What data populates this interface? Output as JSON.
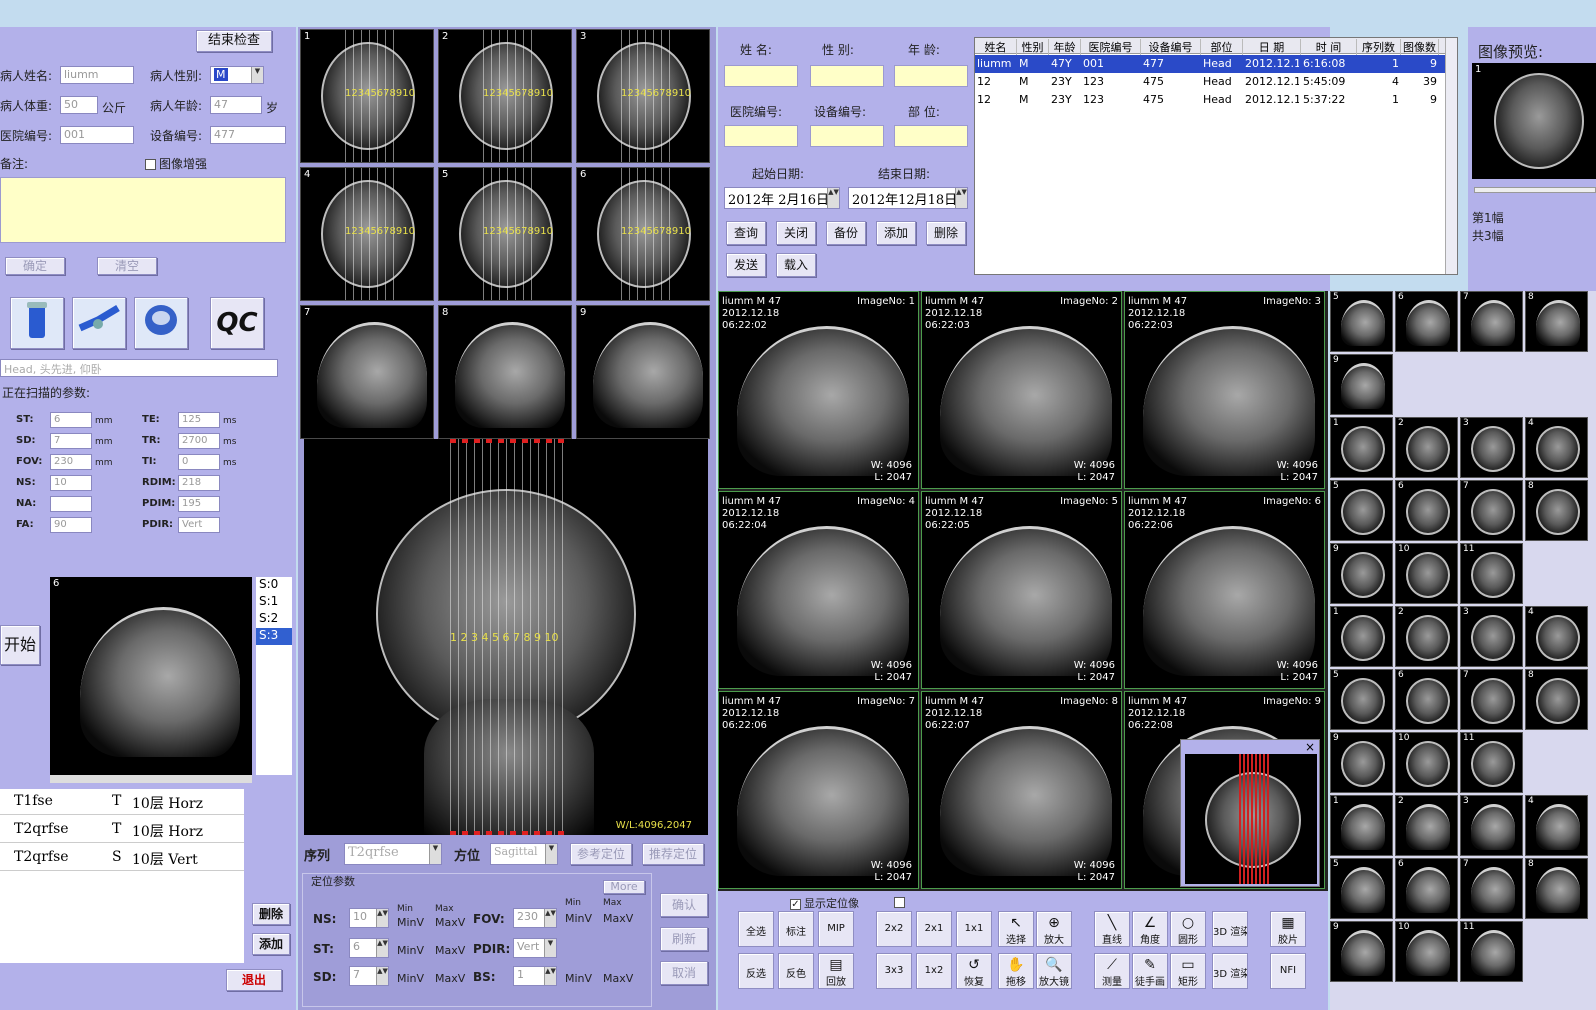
{
  "left_panel": {
    "end_exam_button": "结束检查",
    "patient_name_label": "病人姓名:",
    "patient_name_value": "liumm",
    "patient_sex_label": "病人性别:",
    "patient_sex_value": "M",
    "patient_weight_label": "病人体重:",
    "patient_weight_value": "50",
    "weight_unit": "公斤",
    "patient_age_label": "病人年龄:",
    "patient_age_value": "47",
    "age_unit": "岁",
    "hospital_no_label": "医院编号:",
    "hospital_no_value": "001",
    "device_no_label": "设备编号:",
    "device_no_value": "477",
    "notes_label": "备注:",
    "image_enhance_label": "图像增强",
    "confirm_button": "确定",
    "clear_button": "清空",
    "qc_label": "QC",
    "position_text": "Head, 头先进, 仰卧",
    "scanning_params_label": "正在扫描的参数:",
    "params_left": [
      {
        "label": "ST:",
        "value": "6",
        "unit": "mm"
      },
      {
        "label": "SD:",
        "value": "7",
        "unit": "mm"
      },
      {
        "label": "FOV:",
        "value": "230",
        "unit": "mm"
      },
      {
        "label": "NS:",
        "value": "10",
        "unit": ""
      },
      {
        "label": "NA:",
        "value": "",
        "unit": ""
      },
      {
        "label": "FA:",
        "value": "90",
        "unit": ""
      }
    ],
    "params_right": [
      {
        "label": "TE:",
        "value": "125",
        "unit": "ms"
      },
      {
        "label": "TR:",
        "value": "2700",
        "unit": "ms"
      },
      {
        "label": "TI:",
        "value": "0",
        "unit": "ms"
      },
      {
        "label": "RDIM:",
        "value": "218",
        "unit": ""
      },
      {
        "label": "PDIM:",
        "value": "195",
        "unit": ""
      },
      {
        "label": "PDIR:",
        "value": "Vert",
        "unit": ""
      }
    ],
    "start_button": "开始",
    "slice_list": [
      "S:0",
      "S:1",
      "S:2",
      "S:3"
    ],
    "selected_slice_index": 3,
    "sequences": [
      {
        "name": "T1fse",
        "type": "T",
        "layers": "10层 Horz"
      },
      {
        "name": "T2qrfse",
        "type": "T",
        "layers": "10层 Horz"
      },
      {
        "name": "T2qrfse",
        "type": "S",
        "layers": "10层 Vert"
      }
    ],
    "delete_button": "删除",
    "add_button": "添加",
    "exit_button": "退出"
  },
  "center_panel": {
    "localizer_numbers": [
      "1",
      "2",
      "3",
      "4",
      "5",
      "6",
      "7",
      "8",
      "9"
    ],
    "localizer_overlay_text": "12345678910",
    "slice_markers": "1 2 3 4 5 6 7 8 9 10",
    "wl_text": "W/L:4096,2047",
    "sequence_label": "序列",
    "sequence_value": "T2qrfse",
    "orientation_label": "方位",
    "orientation_value": "Sagittal",
    "ref_position_button": "参考定位",
    "auto_position_button": "推荐定位",
    "position_params_label": "定位参数",
    "more_button": "More",
    "ns_label": "NS:",
    "ns_value": "10",
    "st_label": "ST:",
    "st_value": "6",
    "sd_label": "SD:",
    "sd_value": "7",
    "fov_label": "FOV:",
    "fov_value": "230",
    "pdir_label": "PDIR:",
    "pdir_value": "Vert",
    "bs_label": "BS:",
    "bs_value": "1",
    "min_label": "Min",
    "max_label": "Max",
    "minv_label": "MinV",
    "maxv_label": "MaxV",
    "confirm_button": "确认",
    "refresh_button": "刷新",
    "cancel_button": "取消"
  },
  "search_panel": {
    "name_label": "姓  名:",
    "sex_label": "性  别:",
    "age_label": "年  龄:",
    "hospital_no_label": "医院编号:",
    "device_no_label": "设备编号:",
    "part_label": "部  位:",
    "start_date_label": "起始日期:",
    "end_date_label": "结束日期:",
    "start_date_value": "2012年 2月16日",
    "end_date_value": "2012年12月18日",
    "buttons": [
      "查询",
      "关闭",
      "备份",
      "添加",
      "删除",
      "发送",
      "载入"
    ],
    "table_headers": [
      "姓名",
      "性别",
      "年龄",
      "医院编号",
      "设备编号",
      "部位",
      "日 期",
      "时 间",
      "序列数",
      "图像数"
    ],
    "table_rows": [
      [
        "liumm",
        "M",
        "47Y",
        "001",
        "477",
        "Head",
        "2012.12.18",
        "6:16:08",
        "1",
        "9"
      ],
      [
        "12",
        "M",
        "23Y",
        "123",
        "475",
        "Head",
        "2012.12.18",
        "5:45:09",
        "4",
        "39"
      ],
      [
        "12",
        "M",
        "23Y",
        "123",
        "475",
        "Head",
        "2012.12.18",
        "5:37:22",
        "1",
        "9"
      ]
    ],
    "selected_row": 0
  },
  "preview_panel": {
    "title": "图像预览:",
    "frame_number": "1",
    "current_frame_text": "第1幅",
    "total_frames_text": "共3幅"
  },
  "viewer": {
    "images": [
      {
        "name": "liumm M 47",
        "date": "2012.12.18",
        "time": "06:22:02",
        "image_no": "ImageNo: 1",
        "w": "W: 4096",
        "l": "L: 2047"
      },
      {
        "name": "liumm M 47",
        "date": "2012.12.18",
        "time": "06:22:03",
        "image_no": "ImageNo: 2",
        "w": "W: 4096",
        "l": "L: 2047"
      },
      {
        "name": "liumm M 47",
        "date": "2012.12.18",
        "time": "06:22:03",
        "image_no": "ImageNo: 3",
        "w": "W: 4096",
        "l": "L: 2047"
      },
      {
        "name": "liumm M 47",
        "date": "2012.12.18",
        "time": "06:22:04",
        "image_no": "ImageNo: 4",
        "w": "W: 4096",
        "l": "L: 2047"
      },
      {
        "name": "liumm M 47",
        "date": "2012.12.18",
        "time": "06:22:05",
        "image_no": "ImageNo: 5",
        "w": "W: 4096",
        "l": "L: 2047"
      },
      {
        "name": "liumm M 47",
        "date": "2012.12.18",
        "time": "06:22:06",
        "image_no": "ImageNo: 6",
        "w": "W: 4096",
        "l": "L: 2047"
      },
      {
        "name": "liumm M 47",
        "date": "2012.12.18",
        "time": "06:22:06",
        "image_no": "ImageNo: 7",
        "w": "W: 4096",
        "l": "L: 2047"
      },
      {
        "name": "liumm M 47",
        "date": "2012.12.18",
        "time": "06:22:07",
        "image_no": "ImageNo: 8",
        "w": "W: 4096",
        "l": "L: 2047"
      },
      {
        "name": "liumm M 47",
        "date": "2012.12.18",
        "time": "06:22:08",
        "image_no": "ImageNo: 9",
        "w": "W: 4096",
        "l": "L: 2047"
      }
    ],
    "show_locator_label": "显示定位像",
    "close_popup": "×",
    "toolbar_row1": [
      "全选",
      "标注",
      "MIP",
      "2x2",
      "2x1",
      "1x1",
      "选择",
      "放大",
      "直线",
      "角度",
      "圆形",
      "3D 渲染",
      "胶片"
    ],
    "toolbar_row2": [
      "反选",
      "反色",
      "回放",
      "3x3",
      "1x2",
      "恢复",
      "拖移",
      "放大镜",
      "测量",
      "徒手画",
      "矩形",
      "3D 渲染",
      "NFI"
    ]
  },
  "thumbnails": {
    "groups": [
      [
        "5",
        "6",
        "7",
        "8",
        "9"
      ],
      [
        "1",
        "2",
        "3",
        "4",
        "5",
        "6",
        "7",
        "8",
        "9",
        "10",
        "11"
      ],
      [
        "1",
        "2",
        "3",
        "4",
        "5",
        "6",
        "7",
        "8",
        "9",
        "10",
        "11"
      ],
      [
        "1",
        "2",
        "3",
        "4",
        "5",
        "6",
        "7",
        "8",
        "9",
        "10",
        "11"
      ]
    ]
  }
}
